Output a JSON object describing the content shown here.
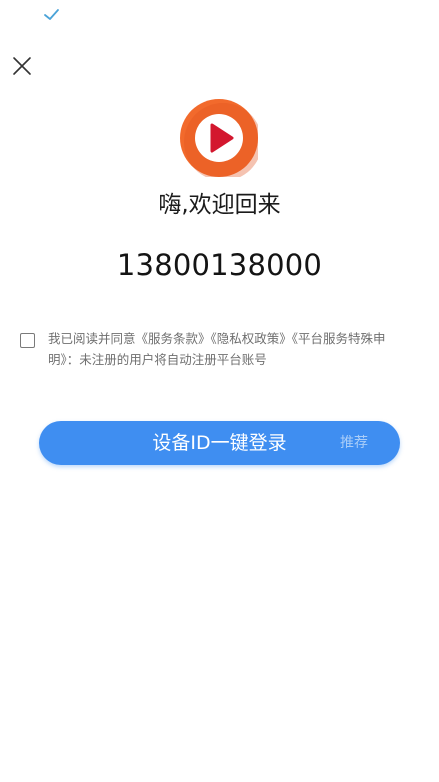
{
  "status_bar": {
    "icon": "check-icon"
  },
  "header": {
    "close_icon": "close-icon"
  },
  "logo": {
    "icon": "video-play-logo",
    "colors": {
      "outer": "#f26a2c",
      "inner": "#ffffff",
      "play": "#d3172e"
    }
  },
  "greeting": "嗨,欢迎回来",
  "phone_number": "13800138000",
  "agreement": {
    "text": "我已阅读并同意《服务条款》《隐私权政策》《平台服务特殊申明》：未注册的用户将自动注册平台账号",
    "checked": false
  },
  "login_button": {
    "label": "设备ID一键登录",
    "tag": "推荐",
    "color": "#3f8ef1"
  }
}
